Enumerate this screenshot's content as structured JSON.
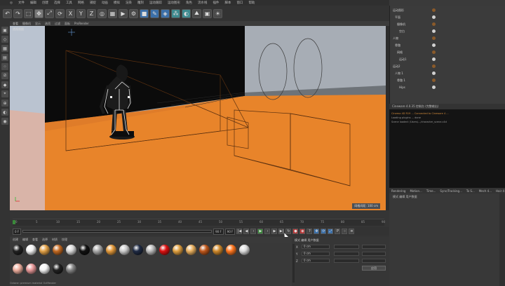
{
  "menubar": {
    "items": [
      "文件",
      "编辑",
      "创建",
      "选择",
      "工具",
      "网格",
      "捕捉",
      "动画",
      "模拟",
      "渲染",
      "雕刻",
      "运动跟踪",
      "运动图形",
      "角色",
      "流水线",
      "插件",
      "脚本",
      "窗口",
      "帮助"
    ]
  },
  "toolbar": {
    "icons": [
      "undo-icon",
      "redo-icon",
      "select-icon",
      "move-icon",
      "scale-icon",
      "rotate-icon",
      "x-axis-icon",
      "y-axis-icon",
      "z-axis-icon",
      "world-icon",
      "render-view-icon",
      "render-icon",
      "render-settings-icon",
      "cube-icon",
      "pen-icon",
      "subdivide-icon",
      "array-icon",
      "deformer-icon",
      "scene-icon",
      "camera-icon",
      "light-icon"
    ],
    "axis_labels": [
      "X",
      "Y",
      "Z"
    ]
  },
  "viewport": {
    "menu": [
      "查看",
      "摄像机",
      "显示",
      "选项",
      "过滤",
      "面板",
      "ProRender"
    ],
    "camera_label": "透视视图",
    "grid_label": "网格间距: 100 cm",
    "colors": {
      "floor": "#e8842a",
      "background": "#0a0a0a",
      "wall": "#9aa3ad"
    }
  },
  "timeline": {
    "ticks": [
      "0",
      "5",
      "10",
      "15",
      "20",
      "25",
      "30",
      "35",
      "40",
      "45",
      "50",
      "55",
      "60",
      "65",
      "70",
      "75",
      "80",
      "85",
      "90"
    ],
    "start_frame": "0 F",
    "end_frame": "90 F",
    "current_frame": "90 F",
    "end_box": "0 F"
  },
  "materials": {
    "menu": [
      "创建",
      "编辑",
      "查看",
      "选择",
      "材质",
      "纹理"
    ],
    "colors": [
      "#222222",
      "#f2f2f2",
      "#e3a248",
      "#c46a22",
      "#d9d9d9",
      "#111111",
      "#aaaaaa",
      "#e39a3c",
      "#cccccc",
      "#1f2b44",
      "#bbbbbb",
      "#dd1111",
      "#e0a040",
      "#e8b060",
      "#c0581c",
      "#d08a2c",
      "#ff7720",
      "#dddddd"
    ],
    "colors_row2": [
      "#f0b0a0",
      "#e89a9a",
      "#f4f4f4",
      "#222222",
      "#888888"
    ]
  },
  "objects": {
    "rows": [
      "运动图形",
      "平面",
      "摄像机",
      "空白",
      "人物",
      "骨骼",
      "网格",
      "运动1",
      "运动2",
      "人物 1",
      "骨骼 1",
      "Hips"
    ]
  },
  "console": {
    "title": "Cineware 4.0.35 控制台 (完整输出)",
    "lines": [
      "Cinema 4D R19 ... Connected to Cineware 4 ...",
      "Loading plugins ... done",
      "Scene loaded: /Users/.../character_scene.c4d"
    ]
  },
  "right_tabs": [
    "Rendering",
    "Motion...",
    "Time...",
    "Sync/Tracking...",
    "To S...",
    "Mech 4...",
    "Hair 4",
    "T-...",
    "U..."
  ],
  "attributes": {
    "header": "模式  编辑  用户数据",
    "labels": [
      "X",
      "Y",
      "Z"
    ],
    "values": [
      "0 cm",
      "0 cm",
      "0 cm"
    ],
    "apply_label": "应用"
  },
  "status": "Octane: premium material OctRender",
  "right_bottom_head": "模式  编辑  用户数据"
}
